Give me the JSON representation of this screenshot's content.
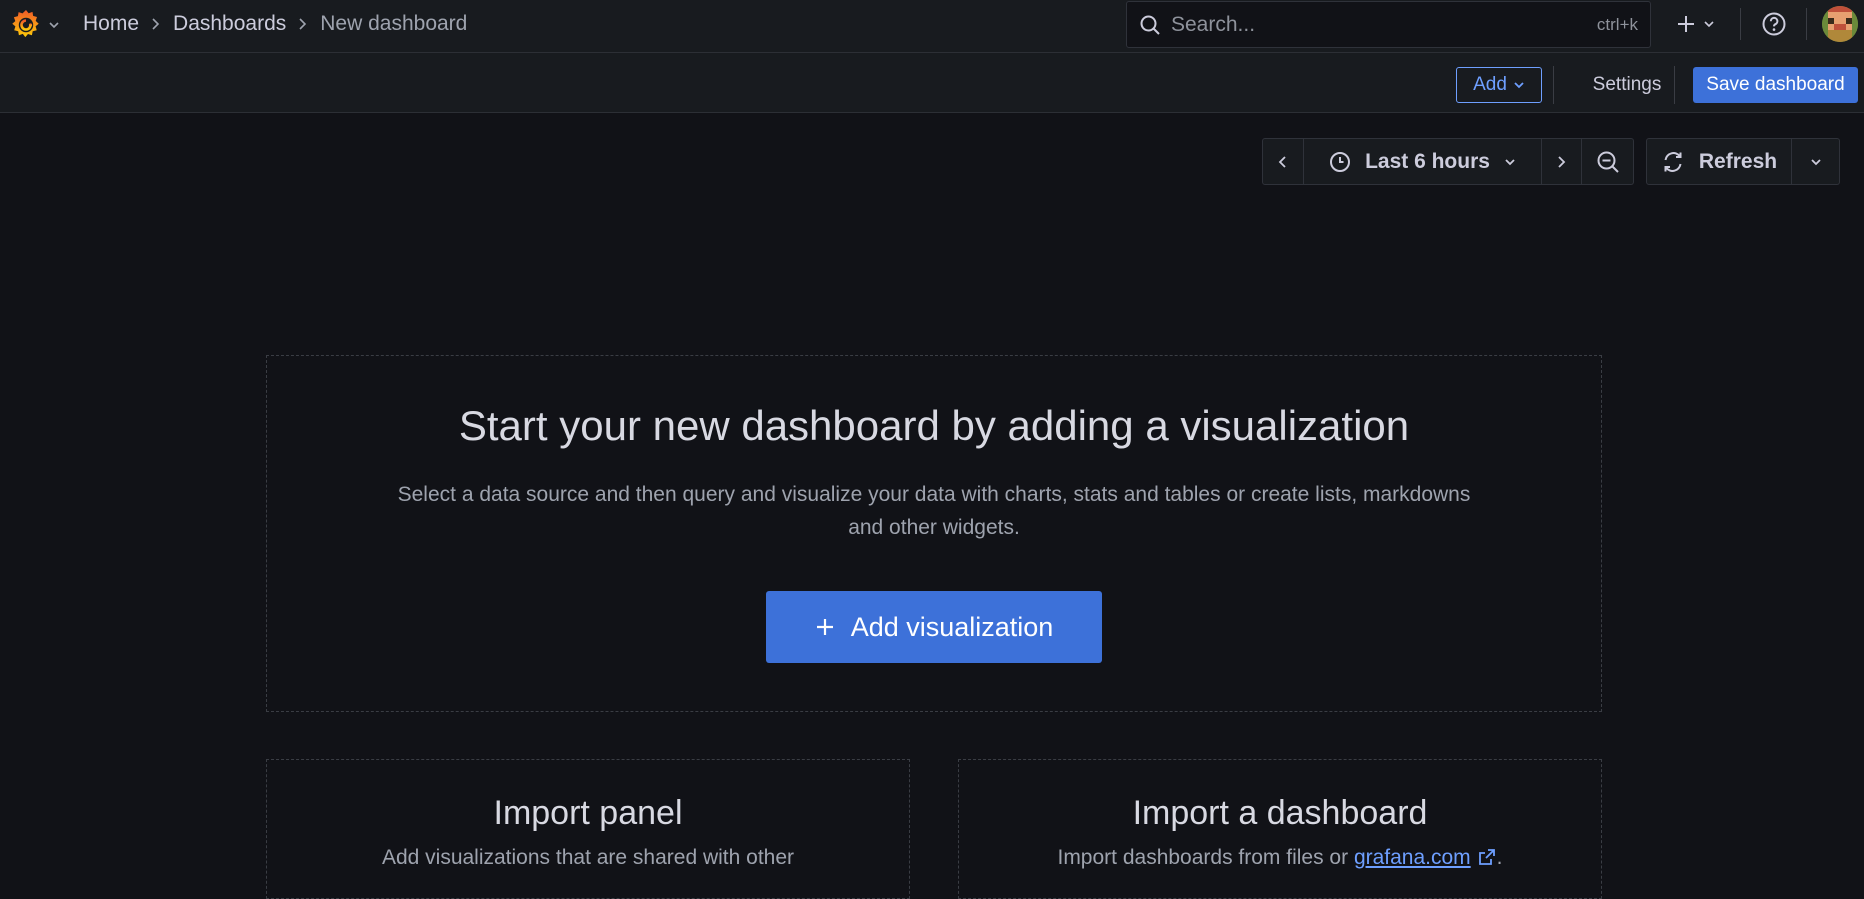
{
  "topbar": {
    "breadcrumbs": [
      {
        "label": "Home"
      },
      {
        "label": "Dashboards"
      },
      {
        "label": "New dashboard"
      }
    ],
    "search": {
      "placeholder": "Search...",
      "shortcut": "ctrl+k"
    },
    "icons": {
      "logo": "grafana-logo-icon",
      "new": "plus-icon",
      "help": "help-circle-icon"
    }
  },
  "toolbar": {
    "add_label": "Add",
    "settings_label": "Settings",
    "save_label": "Save dashboard"
  },
  "time_controls": {
    "range_label": "Last 6 hours",
    "refresh_label": "Refresh"
  },
  "empty_state": {
    "title": "Start your new dashboard by adding a visualization",
    "description": "Select a data source and then query and visualize your data with charts, stats and tables or create lists, markdowns and other widgets.",
    "button_label": "Add visualization"
  },
  "import_panel": {
    "title": "Import panel",
    "description": "Add visualizations that are shared with other"
  },
  "import_dashboard": {
    "title": "Import a dashboard",
    "description_prefix": "Import dashboards from files or ",
    "link_label": "grafana.com",
    "description_suffix": "."
  },
  "colors": {
    "background": "#111217",
    "panel": "#181b1f",
    "primary": "#3d71d9",
    "link": "#6e9fff",
    "logo_orange": "#f46800",
    "logo_yellow": "#fbca0a"
  }
}
